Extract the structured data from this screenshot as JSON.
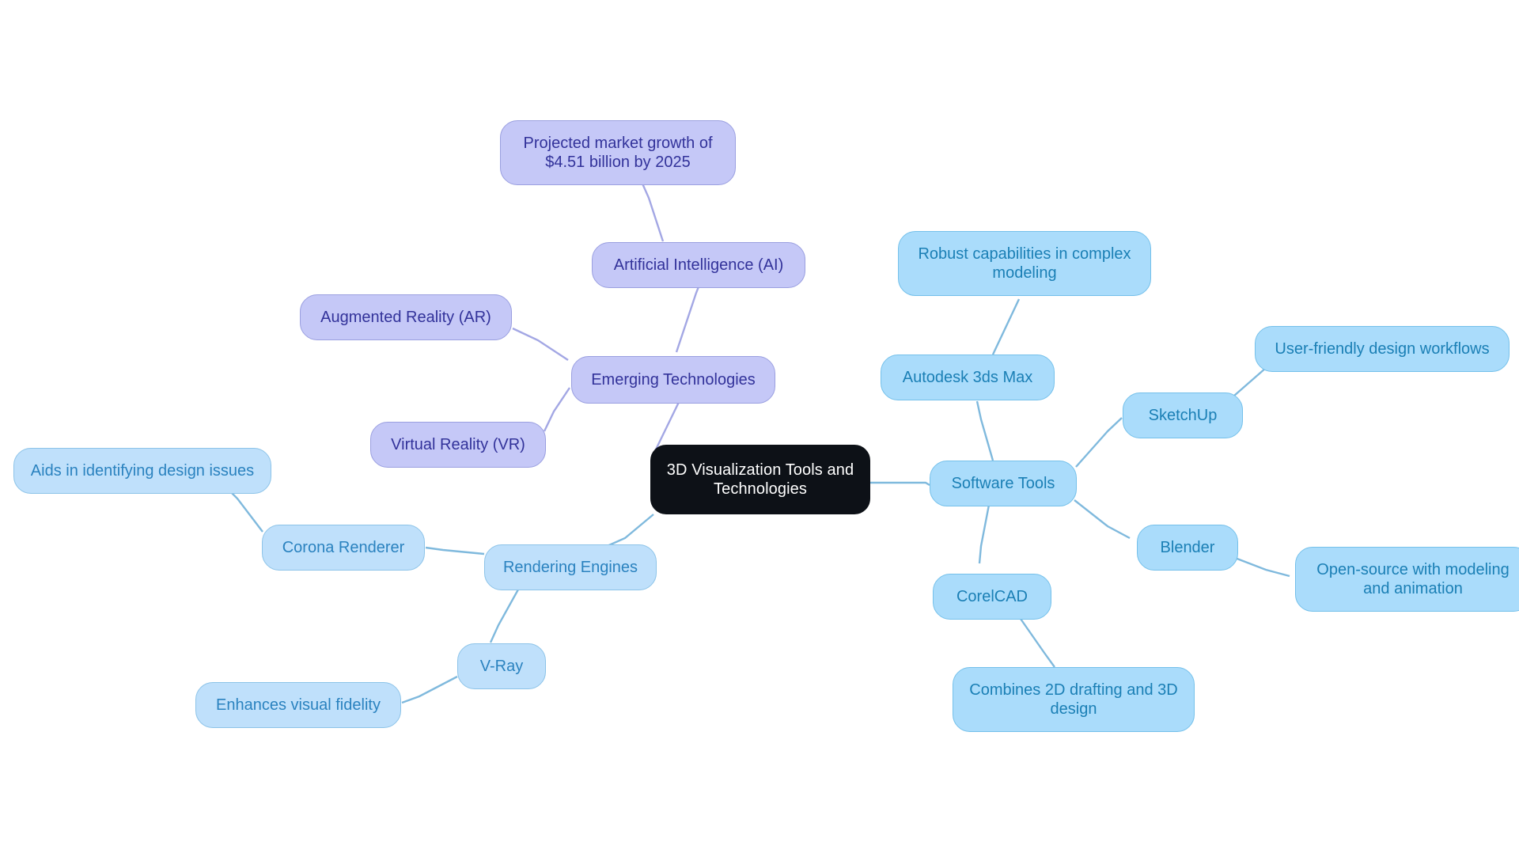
{
  "diagram": {
    "type": "mind-map",
    "title": "3D Visualization Tools and Technologies",
    "background_color": "#ffffff",
    "palette": {
      "root_fill": "#0d1117",
      "root_text": "#ffffff",
      "purple_fill": "#c5c8f7",
      "purple_stroke": "#9a9fe0",
      "purple_text": "#32329a",
      "blue_fill": "#aadcfb",
      "blue_stroke": "#74c0ea",
      "blue_text": "#1a7fb5",
      "blue_soft_fill": "#bfe0fb",
      "blue_soft_stroke": "#8cc3e8",
      "blue_soft_text": "#2a82bf",
      "edge_purple": "#a3a7e4",
      "edge_blue": "#7fb9dd"
    }
  },
  "nodes": {
    "root": {
      "label": "3D Visualization Tools and\nTechnologies"
    },
    "emerging_technologies": {
      "label": "Emerging Technologies"
    },
    "artificial_intelligence": {
      "label": "Artificial Intelligence (AI)"
    },
    "projected_market_growth": {
      "label": "Projected market growth of\n$4.51 billion by 2025"
    },
    "augmented_reality": {
      "label": "Augmented Reality (AR)"
    },
    "virtual_reality": {
      "label": "Virtual Reality (VR)"
    },
    "software_tools": {
      "label": "Software Tools"
    },
    "autodesk_3ds_max": {
      "label": "Autodesk 3ds Max"
    },
    "robust_capabilities": {
      "label": "Robust capabilities in complex\nmodeling"
    },
    "sketchup": {
      "label": "SketchUp"
    },
    "user_friendly_workflows": {
      "label": "User-friendly design workflows"
    },
    "blender": {
      "label": "Blender"
    },
    "open_source_modeling": {
      "label": "Open-source with modeling\nand animation"
    },
    "corelcad": {
      "label": "CorelCAD"
    },
    "combines_2d_3d": {
      "label": "Combines 2D drafting and 3D\ndesign"
    },
    "rendering_engines": {
      "label": "Rendering Engines"
    },
    "corona_renderer": {
      "label": "Corona Renderer"
    },
    "aids_design_issues": {
      "label": "Aids in identifying design issues"
    },
    "v_ray": {
      "label": "V-Ray"
    },
    "enhances_visual_fidelity": {
      "label": "Enhances visual fidelity"
    }
  },
  "branches": [
    {
      "name": "Emerging Technologies",
      "color_group": "purple",
      "children": [
        {
          "name": "Artificial Intelligence (AI)",
          "children": [
            "Projected market growth of $4.51 billion by 2025"
          ]
        },
        {
          "name": "Augmented Reality (AR)",
          "children": []
        },
        {
          "name": "Virtual Reality (VR)",
          "children": []
        }
      ]
    },
    {
      "name": "Software Tools",
      "color_group": "blue",
      "children": [
        {
          "name": "Autodesk 3ds Max",
          "children": [
            "Robust capabilities in complex modeling"
          ]
        },
        {
          "name": "SketchUp",
          "children": [
            "User-friendly design workflows"
          ]
        },
        {
          "name": "Blender",
          "children": [
            "Open-source with modeling and animation"
          ]
        },
        {
          "name": "CorelCAD",
          "children": [
            "Combines 2D drafting and 3D design"
          ]
        }
      ]
    },
    {
      "name": "Rendering Engines",
      "color_group": "blue",
      "children": [
        {
          "name": "Corona Renderer",
          "children": [
            "Aids in identifying design issues"
          ]
        },
        {
          "name": "V-Ray",
          "children": [
            "Enhances visual fidelity"
          ]
        }
      ]
    }
  ]
}
